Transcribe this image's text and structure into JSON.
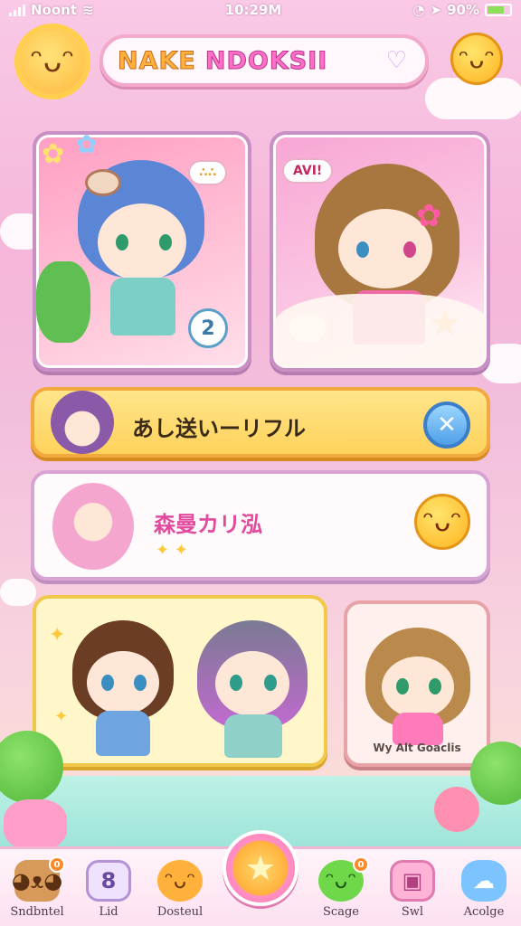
{
  "status_bar": {
    "carrier": "Noont",
    "time": "10:29M",
    "battery": "90%"
  },
  "header": {
    "title_part1": "NAKE",
    "title_part2": "NDOKSII"
  },
  "cards": {
    "card1_badge": "2",
    "card2_speech": "AVI!"
  },
  "banner1": {
    "text": "あし送いーリフル"
  },
  "banner2": {
    "text": "森曼カリ泓"
  },
  "card4": {
    "caption": "Wy Alt Goaclis"
  },
  "nav": {
    "items": [
      {
        "label": "Sndbntel",
        "icon": "dog-icon",
        "badge": "0"
      },
      {
        "label": "Lid",
        "icon": "number-8-icon",
        "badge": ""
      },
      {
        "label": "Dosteul",
        "icon": "orange-face-icon",
        "badge": ""
      },
      {
        "label": "Scage",
        "icon": "green-frog-icon",
        "badge": "0"
      },
      {
        "label": "Swl",
        "icon": "pink-jar-icon",
        "badge": ""
      },
      {
        "label": "Acolge",
        "icon": "blue-cloud-icon",
        "badge": ""
      }
    ],
    "center_icon": "star-icon"
  },
  "colors": {
    "accent_pink": "#f3a9cc",
    "accent_yellow": "#ffd25c",
    "accent_blue": "#4f9fe8"
  }
}
